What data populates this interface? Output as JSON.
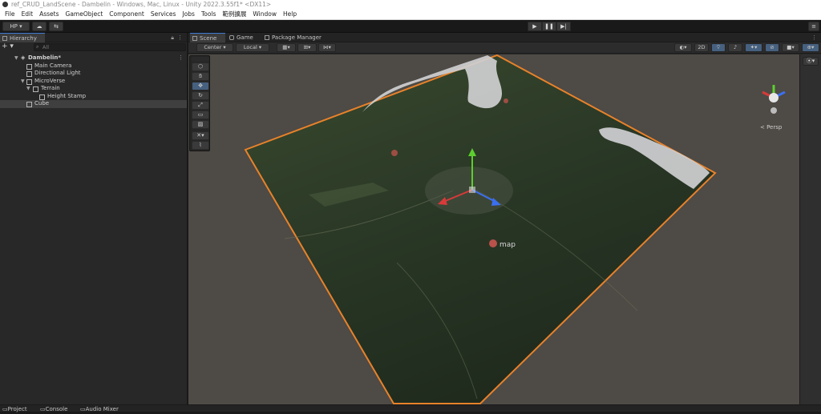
{
  "window": {
    "title": "ref_CRUD_LandScene - Dambelin - Windows, Mac, Linux - Unity 2022.3.55f1* <DX11>"
  },
  "menu": [
    "File",
    "Edit",
    "Assets",
    "GameObject",
    "Component",
    "Services",
    "Jobs",
    "Tools",
    "範例擴展",
    "Window",
    "Help"
  ],
  "toolbar": {
    "account": "HP ▾",
    "cloud": "☁",
    "collab": "⇆",
    "play": "▶",
    "pause": "❚❚",
    "step": "▶|"
  },
  "hierarchy": {
    "tab": "Hierarchy",
    "search_placeholder": "All",
    "add": "+ ▾",
    "items": [
      {
        "label": "Dambelin*"
      },
      {
        "label": "Main Camera"
      },
      {
        "label": "Directional Light"
      },
      {
        "label": "MicroVerse"
      },
      {
        "label": "Terrain"
      },
      {
        "label": "Height Stamp"
      },
      {
        "label": "Cube"
      }
    ]
  },
  "scene": {
    "tabs": [
      "Scene",
      "Game",
      "Package Manager"
    ],
    "pivot": "Center ▾",
    "space": "Local ▾",
    "mode_2d": "2D",
    "persp_label": "< Persp",
    "map_label": "map"
  },
  "bottom_tabs": [
    "Project",
    "Console",
    "Audio Mixer"
  ],
  "colors": {
    "selection_outline": "#e8822a",
    "accent": "#3e7bd6",
    "gizmo_x": "#d83a3a",
    "gizmo_y": "#5ccf2e",
    "gizmo_z": "#3b6ff0"
  }
}
